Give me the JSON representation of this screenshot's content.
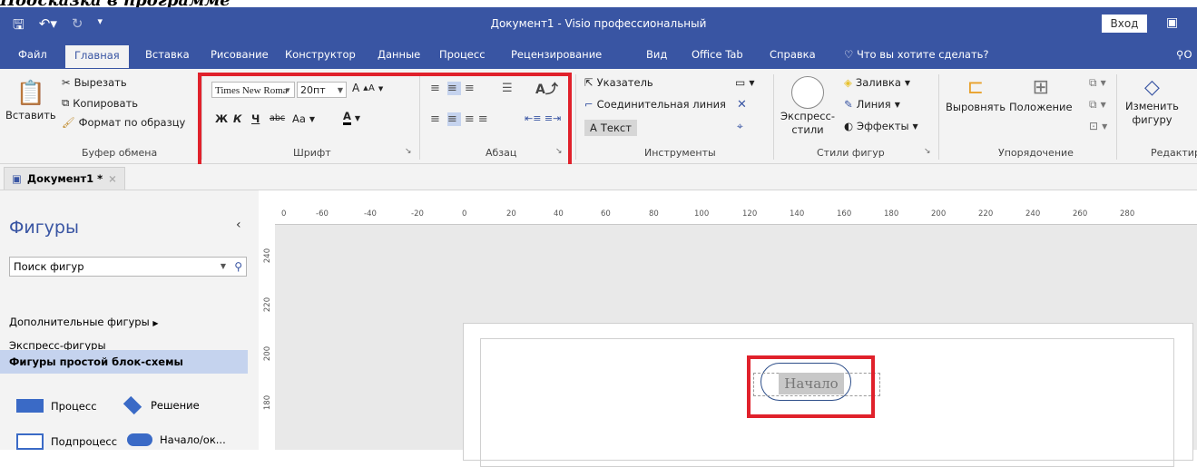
{
  "caption": "Подсказка в программе",
  "titlebar": {
    "title": "Документ1  -  Visio профессиональный",
    "login": "Вход",
    "save_icon": "save-icon",
    "undo_icon": "undo-icon",
    "redo_icon": "redo-icon",
    "customize_icon": "customize-qat-icon",
    "ribbon_display_icon": "ribbon-display-options-icon"
  },
  "menu": {
    "tabs": [
      "Файл",
      "Главная",
      "Вставка",
      "Рисование",
      "Конструктор",
      "Данные",
      "Процесс",
      "Рецензирование",
      "Вид",
      "Office Tab",
      "Справка"
    ],
    "tell_me": "Что вы хотите сделать?",
    "share": "О"
  },
  "ribbon": {
    "clipboard": {
      "paste": "Вставить",
      "cut": "Вырезать",
      "copy": "Копировать",
      "format_painter": "Формат по образцу",
      "label": "Буфер обмена"
    },
    "font": {
      "name": "Times New Roma",
      "size": "20пт",
      "bold": "Ж",
      "italic": "К",
      "underline": "Ч",
      "strike": "abc",
      "case": "Aa",
      "color": "A",
      "grow": "A",
      "shrink": "A",
      "label": "Шрифт"
    },
    "paragraph": {
      "label": "Абзац"
    },
    "tools": {
      "pointer": "Указатель",
      "connector": "Соединительная линия",
      "text": "Текст",
      "label": "Инструменты"
    },
    "shape_styles": {
      "quick": "Экспресс-",
      "quick2": "стили",
      "fill": "Заливка",
      "line": "Линия",
      "effects": "Эффекты",
      "label": "Стили фигур"
    },
    "arrange": {
      "align": "Выровнять",
      "position": "Положение",
      "label": "Упорядочение"
    },
    "edit": {
      "change": "Изменить",
      "change2": "фигуру",
      "label": "Редактир"
    }
  },
  "doc_tab": {
    "name": "Документ1 *",
    "close": "×"
  },
  "shapes_pane": {
    "title": "Фигуры",
    "search_placeholder": "Поиск фигур",
    "more": "Дополнительные фигуры",
    "quick": "Экспресс-фигуры",
    "basic_flowchart": "Фигуры простой блок-схемы",
    "shapes": [
      {
        "label": "Процесс"
      },
      {
        "label": "Решение"
      },
      {
        "label": "Подпроцесс"
      },
      {
        "label": "Начало/ок..."
      }
    ]
  },
  "ruler": {
    "h_ticks": [
      "0",
      "-60",
      "-40",
      "-20",
      "0",
      "20",
      "40",
      "60",
      "80",
      "100",
      "120",
      "140",
      "160",
      "180",
      "200",
      "220",
      "240",
      "260",
      "280"
    ],
    "v_ticks": [
      "240",
      "220",
      "200",
      "180"
    ]
  },
  "canvas": {
    "start_text": "Начало"
  },
  "colors": {
    "accent": "#3955a3",
    "highlight": "#e0212b"
  }
}
